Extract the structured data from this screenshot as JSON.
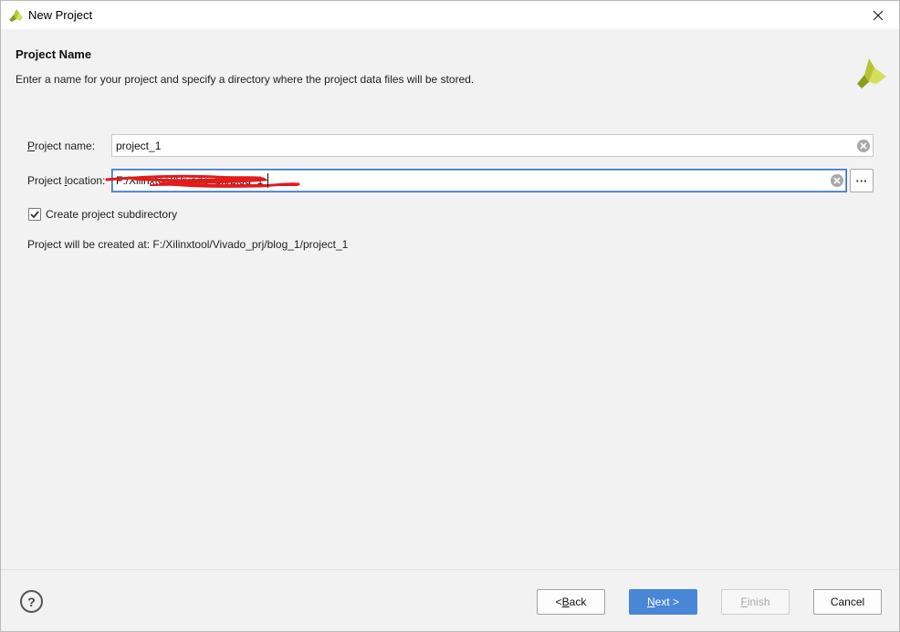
{
  "window": {
    "title": "New Project",
    "close_icon": "close-icon",
    "app_icon": "vivado-logo-icon"
  },
  "header": {
    "heading": "Project Name",
    "description": "Enter a name for your project and specify a directory where the project data files will be stored."
  },
  "form": {
    "project_name": {
      "label_mnemonic": "P",
      "label_rest": "roject name:",
      "value": "project_1"
    },
    "project_location": {
      "label_prefix": "Project ",
      "label_mnemonic": "l",
      "label_rest": "ocation:",
      "value": "F:/Xilinxtool/Vivado_prj/blog_1",
      "redacted": true
    },
    "browse_label": "···",
    "create_subdirectory": {
      "label": "Create project subdirectory",
      "checked": true
    },
    "info_text": "Project will be created at: F:/Xilinxtool/Vivado_prj/blog_1/project_1"
  },
  "footer": {
    "help_label": "?",
    "back": {
      "prefix": "< ",
      "mnemonic": "B",
      "rest": "ack"
    },
    "next": {
      "mnemonic": "N",
      "rest": "ext >"
    },
    "finish": {
      "mnemonic": "F",
      "rest": "inish",
      "disabled": true
    },
    "cancel": {
      "label": "Cancel"
    }
  },
  "colors": {
    "accent": "#4a86d6",
    "focus_border": "#3d78c7",
    "logo_dark": "#8c9c22",
    "logo_light": "#d4e05a",
    "redaction": "#e21b1b"
  }
}
